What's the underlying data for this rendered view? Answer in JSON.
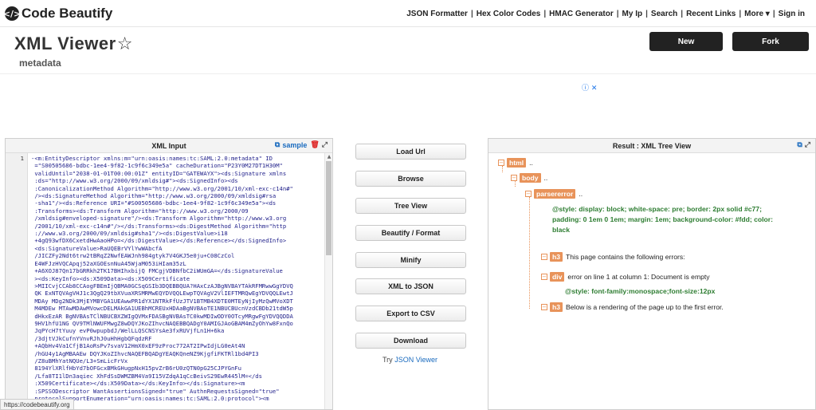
{
  "header": {
    "logo_text": "Code Beautify",
    "nav": [
      "JSON Formatter",
      "Hex Color Codes",
      "HMAC Generator",
      "My Ip",
      "Search",
      "Recent Links",
      "More ▾",
      "Sign in"
    ]
  },
  "page": {
    "title": "XML Viewer",
    "subtitle": "metadata",
    "new_label": "New",
    "fork_label": "Fork"
  },
  "input_panel": {
    "title": "XML Input",
    "sample_label": "sample",
    "line_number": "1",
    "code_lines": [
      "-<m:EntityDescriptor xmlns:m=\"urn:oasis:names:tc:SAML:2.0:metadata\" ID",
      " =\"S00505686-bdbc-1ee4-9f82-1c9f6c349e5a\" cacheDuration=\"P23Y0M27DT1H30M\"",
      " validUntil=\"2038-01-01T00:00:01Z\" entityID=\"GATEWAYX\"><ds:Signature xmlns",
      " :ds=\"http://www.w3.org/2000/09/xmldsig#\"><ds:SignedInfo><ds",
      " :CanonicalizationMethod Algorithm=\"http://www.w3.org/2001/10/xml-exc-c14n#\"",
      " /><ds:SignatureMethod Algorithm=\"http://www.w3.org/2000/09/xmldsig#rsa",
      " -sha1\"/><ds:Reference URI=\"#S00505686-bdbc-1ee4-9f82-1c9f6c349e5a\"><ds",
      " :Transforms><ds:Transform Algorithm=\"http://www.w3.org/2000/09",
      " /xmldsig#enveloped-signature\"/><ds:Transform Algorithm=\"http://www.w3.org",
      " /2001/10/xml-exc-c14n#\"/></ds:Transforms><ds:DigestMethod Algorithm=\"http",
      " ://www.w3.org/2000/09/xmldsig#sha1\"/><ds:DigestValue>i18",
      " +4gQ93wfDX6CxetdHwAaoHPo=</ds:DigestValue></ds:Reference></ds:SignedInfo>",
      " <ds:SignatureValue>RaUQEBrVYlYwWAbcfA",
      " /JICZFy2Ndt6trw2tBRqZ2NwfEAWJnh984gtyk7V4GKJ5e0ju+C08CzCol",
      " E4WFJzHVQCApqj52aXGOEsnNuA45WjaM053iHIam35zL",
      " +A6XOJ87Qn17bGRRkh2TK17BHIhxbijQ FMCgjVDBNfbC2iWUmGA=</ds:SignatureValue",
      " ><ds:KeyInfo><ds:X509Data><ds:X509Certificate",
      " >MIICvjCCAb8CCAogFBEmIjQBMA0GCSqGSIb3DQEBBQUA?HAxCzAJBgNVBAYTAkRFMRwwGgYDVQ",
      " QK ExNTQVAgVHJ1c3QgQ29tbXVuaXRSMRMwEQYDVQQLEwpTQVAgV2VlIEFTMRQwEgYDVQQLEwtJ",
      " MDAy MDg2NDk3MjEYMBYGA1UEAwwPR1dYX1NTRkFfUzJTV1BTMB4XDTE0MTEyNjIyMzQwMVoXDT",
      " M4MDEw MTAwMDAwMVowcDELMAkGA1UEBhMCREUxHDAaBgNVBAoTE1NBUCBUcnVzdCBDb21tdW5p",
      " dHkxEzAR BgNVBAsTClNBUCBXZWIgQVMxFDASBgNVBAsTC0kwMDIwODY0OTcyMRgwFgYDVQQDDA",
      " 9HV1hfU1NG QV9TMlNWUFMwgZ8wDQYJKoZIhvcNAQEBBQADgY0AMIGJAoGBAM4mZyOhYw8FxnQo",
      " JqPYcH7tYuuy evP0wpupbdJ/WelLLQSCNSYsAe3fxRUVjfLn1H+6ka",
      " /3djtVJkCufnYVnvRJhJ0uHhHgbQFqdzRF",
      " +AQbHv4Va1CfjB1AoRsPv7svaV12HmX0xEF9zProc772AT2IPwIdjLG0eAt4N",
      " /hGU4y1AgMBAAEw DQYJKoZIhvcNAQEFBQADgYEAQKQneNZ9KjgfiFKTRl1bd4PI3",
      " /Z8uBMhYatNQUe/L3+SmLicFrVx",
      " 8194YlXRlfHbYd7bOFGcxBMkGHugpNxH15pvZrB6rU0zQTN0pG25CJPYGnFu",
      " /Lfa8TI1lDn3aqiec XhFdSsDWMZBM4Va9I15VZdqA1qCcBeivS29EwR445lM=</ds",
      " :X509Certificate></ds:X509Data></ds:KeyInfo></ds:Signature><m",
      " :SPSSODescriptor WantAssertionsSigned=\"true\" AuthnRequestsSigned=\"true\"",
      " protocolSupportEnumeration=\"urn:oasis:names:tc:SAML:2.0:protocol\"><m"
    ]
  },
  "actions": {
    "buttons": [
      "Load Url",
      "Browse",
      "Tree View",
      "Beautify / Format",
      "Minify",
      "XML to JSON",
      "Export to CSV",
      "Download"
    ],
    "try_prefix": "Try",
    "try_link": "JSON Viewer"
  },
  "result_panel": {
    "title": "Result : XML Tree View",
    "tree": {
      "html_tag": "html",
      "body_tag": "body",
      "parsererror_tag": "parsererror",
      "ellipsis": "..",
      "style_name": "@style:",
      "style_value_1": "display: block; white-space: pre; border: 2px solid #c77;",
      "style_value_2": "padding: 0 1em 0 1em; margin: 1em; background-color: #fdd; color:",
      "style_value_3": "black",
      "h3_tag": "h3",
      "h3_text": "This page contains the following errors:",
      "div_tag": "div",
      "div_text": "error on line 1 at column 1: Document is empty",
      "div_style_name": "@style:",
      "div_style_value": "font-family:monospace;font-size:12px",
      "h3b_text": "Below is a rendering of the page up to the first error."
    }
  },
  "status_bar": {
    "url": "https://codebeautify.org"
  },
  "colors": {
    "tag_orange": "#e8935a",
    "link_blue": "#1a6bbf",
    "dark_button": "#222222"
  }
}
